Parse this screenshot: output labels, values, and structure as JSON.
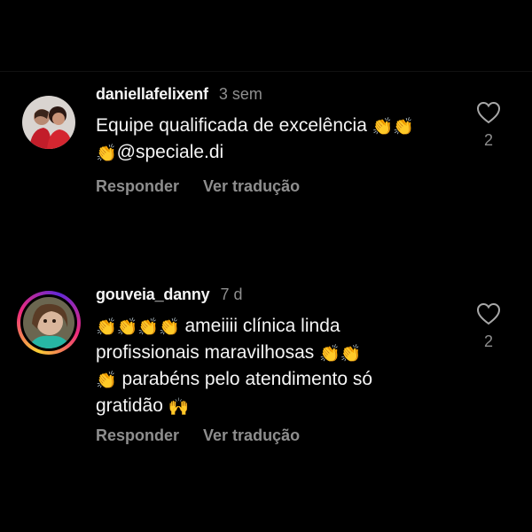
{
  "colors": {
    "background": "#000000",
    "text_primary": "#f5f5f5",
    "text_secondary": "#8e8e8e",
    "story_ring": [
      "#f9ce34",
      "#ee2a7b",
      "#6228d7"
    ]
  },
  "comments": [
    {
      "username": "daniellafelixenf",
      "time": "3 sem",
      "lines": [
        {
          "text": "Equipe qualificada de excelência ",
          "emoji": "👏👏"
        },
        {
          "emoji": "👏",
          "text": "@speciale.di"
        }
      ],
      "reply_label": "Responder",
      "translate_label": "Ver tradução",
      "likes": "2",
      "avatar_icon": "avatar-photo",
      "like_icon": "heart-outline-icon"
    },
    {
      "username": "gouveia_danny",
      "time": "7 d",
      "lines": [
        {
          "emoji": "👏👏👏👏",
          "text": " ameiiii clínica linda"
        },
        {
          "text": "profissionais maravilhosas ",
          "emoji": "👏👏"
        },
        {
          "emoji": "👏",
          "text": " parabéns pelo atendimento só"
        },
        {
          "text": "gratidão ",
          "emoji": "🙌"
        }
      ],
      "reply_label": "Responder",
      "translate_label": "Ver tradução",
      "likes": "2",
      "avatar_icon": "avatar-photo",
      "like_icon": "heart-outline-icon"
    }
  ]
}
